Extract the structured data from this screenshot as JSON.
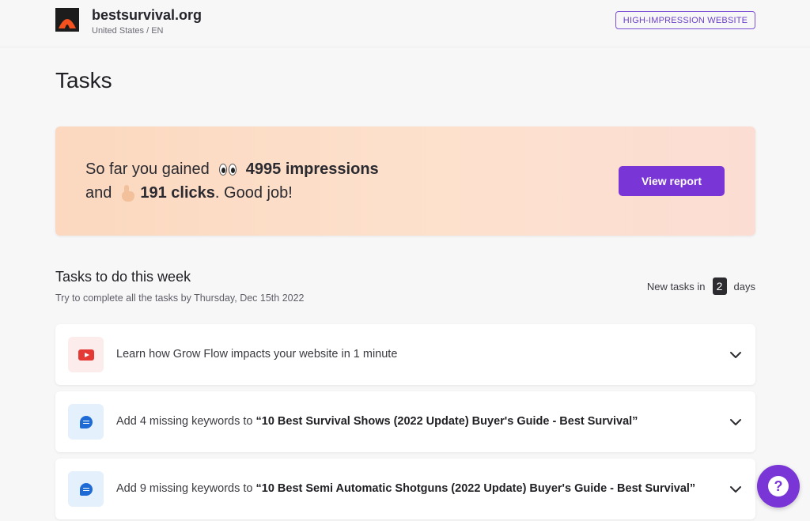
{
  "header": {
    "site_name": "bestsurvival.org",
    "locale": "United States / EN",
    "badge": "HIGH-IMPRESSION WEBSITE"
  },
  "page": {
    "title": "Tasks"
  },
  "banner": {
    "prefix": "So far you gained",
    "impressions": "4995 impressions",
    "and": "and",
    "clicks": "191 clicks",
    "suffix": ". Good job!",
    "button": "View report"
  },
  "week": {
    "title": "Tasks to do this week",
    "subtitle": "Try to complete all the tasks by Thursday, Dec 15th 2022",
    "new_tasks_prefix": "New tasks in",
    "new_tasks_days": "2",
    "new_tasks_suffix": "days"
  },
  "tasks": [
    {
      "icon": "youtube-icon",
      "text": "Learn how Grow Flow impacts your website in 1 minute"
    },
    {
      "icon": "chat-doc-icon",
      "prefix": "Add 4 missing keywords to ",
      "title": "“10 Best Survival Shows (2022 Update) Buyer's Guide - Best Survival”"
    },
    {
      "icon": "chat-doc-icon",
      "prefix": "Add 9 missing keywords to ",
      "title": "“10 Best Semi Automatic Shotguns (2022 Update) Buyer's Guide - Best Survival”"
    }
  ],
  "help": {
    "label": "?"
  }
}
